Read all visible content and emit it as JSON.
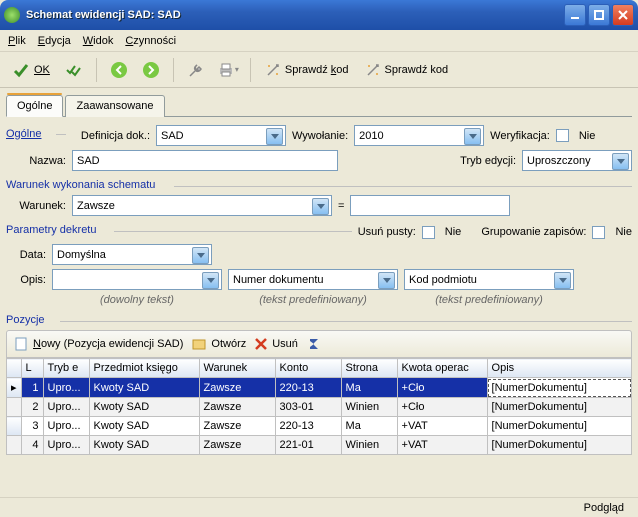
{
  "window": {
    "title": "Schemat ewidencji SAD: SAD"
  },
  "menu": {
    "plik": "Plik",
    "edycja": "Edycja",
    "widok": "Widok",
    "czynnosci": "Czynności"
  },
  "toolbar": {
    "ok": "OK",
    "sprawdz1": "Sprawdź kod",
    "sprawdz2": "Sprawdź kod"
  },
  "tabs": {
    "ogolne": "Ogólne",
    "zaaw": "Zaawansowane"
  },
  "labels": {
    "ogolne": "Ogólne",
    "definicja": "Definicja dok.:",
    "wywolanie": "Wywołanie:",
    "weryfikacja": "Weryfikacja:",
    "nazwa": "Nazwa:",
    "tryb": "Tryb edycji:",
    "nie": "Nie",
    "warunek_grp": "Warunek wykonania schematu",
    "warunek": "Warunek:",
    "rowna": "=",
    "param_grp": "Parametry dekretu",
    "usun_pusty": "Usuń pusty:",
    "grupowanie": "Grupowanie zapisów:",
    "data": "Data:",
    "opis": "Opis:",
    "hint_dowolny": "(dowolny tekst)",
    "hint_pred": "(tekst predefiniowany)",
    "pozycje": "Pozycje",
    "nowy": "Nowy (Pozycja ewidencji SAD)",
    "otworz": "Otwórz",
    "usun": "Usuń"
  },
  "values": {
    "definicja": "SAD",
    "wywolanie": "2010",
    "nazwa": "SAD",
    "tryb": "Uproszczony",
    "warunek": "Zawsze",
    "data": "Domyślna",
    "opis_text": "",
    "opis_pred": "Numer dokumentu",
    "opis_pred2": "Kod podmiotu"
  },
  "grid": {
    "headers": {
      "l": "L",
      "tryb": "Tryb e",
      "przedmiot": "Przedmiot księgo",
      "warunek": "Warunek",
      "konto": "Konto",
      "strona": "Strona",
      "kwota": "Kwota operac",
      "opis": "Opis"
    },
    "rows": [
      {
        "l": "1",
        "tryb": "Upro...",
        "przedmiot": "Kwoty SAD",
        "warunek": "Zawsze",
        "konto": "220-13",
        "strona": "Ma",
        "kwota": "+Cło",
        "opis": "[NumerDokumentu]"
      },
      {
        "l": "2",
        "tryb": "Upro...",
        "przedmiot": "Kwoty SAD",
        "warunek": "Zawsze",
        "konto": "303-01",
        "strona": "Winien",
        "kwota": "+Cło",
        "opis": "[NumerDokumentu]"
      },
      {
        "l": "3",
        "tryb": "Upro...",
        "przedmiot": "Kwoty SAD",
        "warunek": "Zawsze",
        "konto": "220-13",
        "strona": "Ma",
        "kwota": "+VAT",
        "opis": "[NumerDokumentu]"
      },
      {
        "l": "4",
        "tryb": "Upro...",
        "przedmiot": "Kwoty SAD",
        "warunek": "Zawsze",
        "konto": "221-01",
        "strona": "Winien",
        "kwota": "+VAT",
        "opis": "[NumerDokumentu]"
      }
    ]
  },
  "status": {
    "podglad": "Podgląd"
  }
}
